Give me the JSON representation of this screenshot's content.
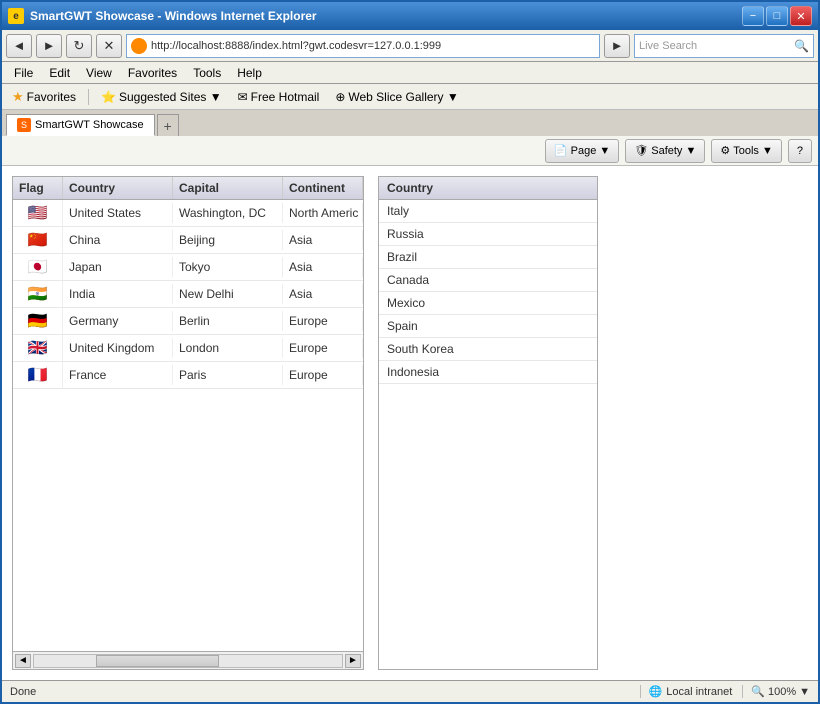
{
  "window": {
    "title": "SmartGWT Showcase - Windows Internet Explorer",
    "minimize": "−",
    "restore": "□",
    "close": "✕"
  },
  "menu": {
    "items": [
      "File",
      "Edit",
      "View",
      "Favorites",
      "Tools",
      "Help"
    ]
  },
  "addressbar": {
    "back": "◄",
    "forward": "►",
    "refresh": "↻",
    "stop": "✕",
    "url": "http://localhost:8888/index.html?gwt.codesvr=127.0.0.1:999",
    "search_placeholder": "Live Search",
    "go_icon": "►"
  },
  "favorites": {
    "label": "Favorites",
    "items": [
      {
        "label": "Suggested Sites ▼",
        "icon": "★"
      },
      {
        "label": "Free Hotmail",
        "icon": "✉"
      },
      {
        "label": "Web Slice Gallery ▼",
        "icon": "⊕"
      }
    ]
  },
  "tabs": [
    {
      "label": "SmartGWT Showcase",
      "active": true
    }
  ],
  "toolbar": {
    "page_btn": "Page ▼",
    "safety_btn": "Safety ▼",
    "tools_btn": "Tools ▼",
    "help_btn": "?"
  },
  "left_grid": {
    "columns": [
      "Flag",
      "Country",
      "Capital",
      "Continent"
    ],
    "rows": [
      {
        "flag": "🇺🇸",
        "country": "United States",
        "capital": "Washington, DC",
        "continent": "North Americ"
      },
      {
        "flag": "🇨🇳",
        "country": "China",
        "capital": "Beijing",
        "continent": "Asia"
      },
      {
        "flag": "🇯🇵",
        "country": "Japan",
        "capital": "Tokyo",
        "continent": "Asia"
      },
      {
        "flag": "🇮🇳",
        "country": "India",
        "capital": "New Delhi",
        "continent": "Asia"
      },
      {
        "flag": "🇩🇪",
        "country": "Germany",
        "capital": "Berlin",
        "continent": "Europe"
      },
      {
        "flag": "🇬🇧",
        "country": "United Kingdom",
        "capital": "London",
        "continent": "Europe"
      },
      {
        "flag": "🇫🇷",
        "country": "France",
        "capital": "Paris",
        "continent": "Europe"
      }
    ]
  },
  "right_grid": {
    "column": "Country",
    "rows": [
      "Italy",
      "Russia",
      "Brazil",
      "Canada",
      "Mexico",
      "Spain",
      "South Korea",
      "Indonesia"
    ]
  },
  "status": {
    "text": "Done",
    "zone": "Local intranet",
    "zoom": "100%"
  }
}
